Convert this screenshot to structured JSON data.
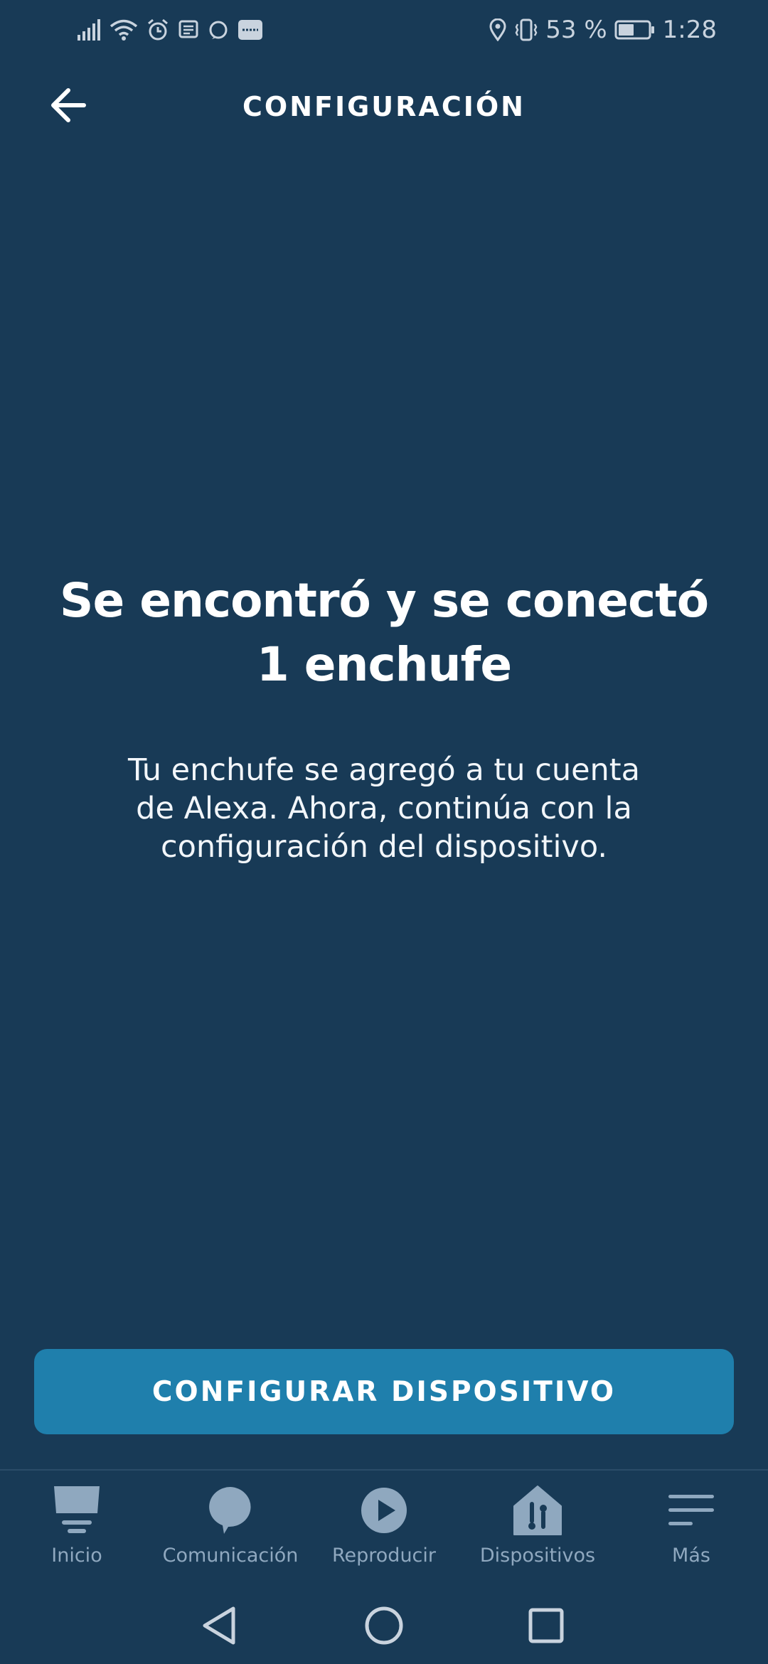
{
  "status_bar": {
    "battery_percent": "53 %",
    "time": "1:28",
    "icons": [
      "signal-icon",
      "wifi-icon",
      "alarm-icon",
      "message-icon",
      "alexa-icon",
      "ifttt-icon",
      "location-icon",
      "vibrate-icon",
      "battery-icon"
    ],
    "battery_level": 0.53
  },
  "header": {
    "title": "CONFIGURACIÓN",
    "back_icon": "arrow-left-icon"
  },
  "main": {
    "heading_line1": "Se encontró y se conectó",
    "heading_line2": "1 enchufe",
    "body_line1": "Tu enchufe se agregó a tu cuenta",
    "body_line2": "de Alexa. Ahora, continúa con la",
    "body_line3": "configuración del dispositivo."
  },
  "button": {
    "label": "CONFIGURAR DISPOSITIVO"
  },
  "bottom_nav": {
    "items": [
      {
        "label": "Inicio",
        "icon": "home-icon"
      },
      {
        "label": "Comunicación",
        "icon": "chat-icon"
      },
      {
        "label": "Reproducir",
        "icon": "play-icon"
      },
      {
        "label": "Dispositivos",
        "icon": "devices-icon"
      },
      {
        "label": "Más",
        "icon": "menu-icon"
      }
    ]
  },
  "system_nav": {
    "icons": [
      "back-triangle-icon",
      "home-circle-icon",
      "recents-square-icon"
    ]
  },
  "colors": {
    "background": "#183a56",
    "button": "#1f7fac",
    "nav_label": "#8fa8bf",
    "status": "#c9d3de"
  }
}
